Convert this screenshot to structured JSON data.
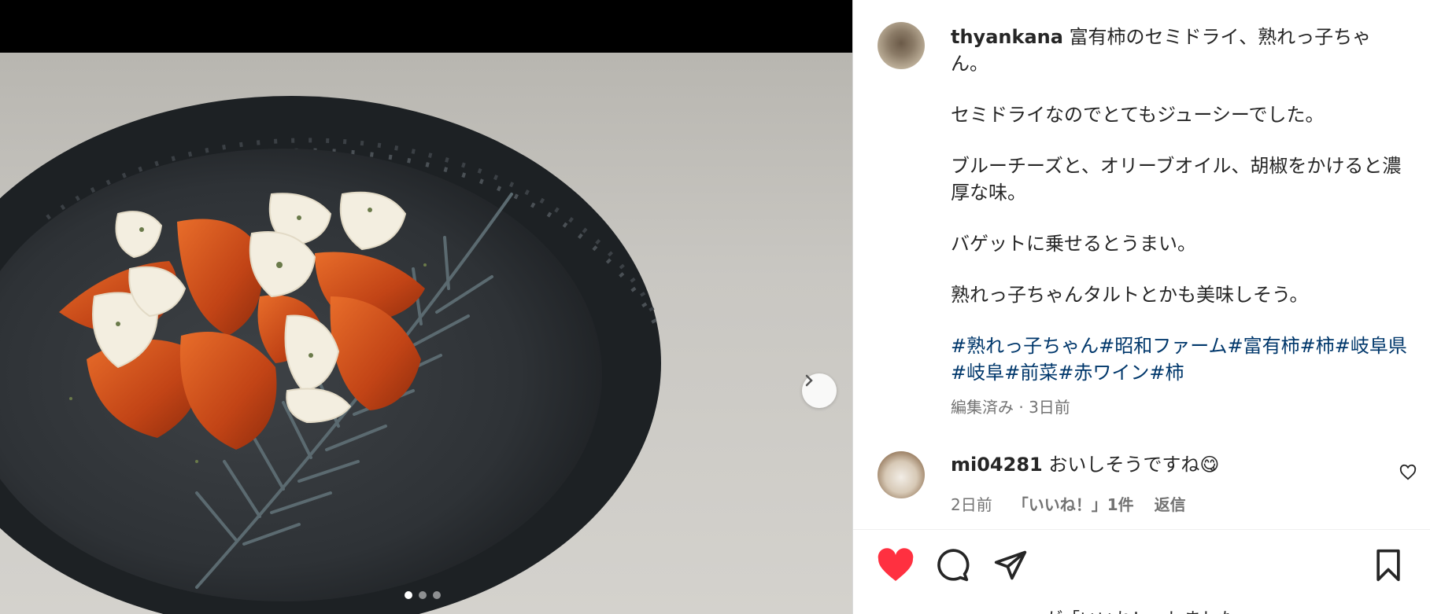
{
  "post": {
    "username": "thyankana",
    "caption_first": "富有柿のセミドライ、熟れっ子ちゃん。",
    "paragraphs": [
      "セミドライなのでとてもジューシーでした。",
      "ブルーチーズと、オリーブオイル、胡椒をかけると濃厚な味。",
      "バゲットに乗せるとうまい。",
      "熟れっ子ちゃんタルトとかも美味しそう。"
    ],
    "hashtags": [
      "#熟れっ子ちゃん",
      "#昭和ファーム",
      "#富有柿",
      "#柿",
      "#岐阜県",
      "#岐阜",
      "#前菜",
      "#赤ワイン",
      "#柿"
    ],
    "edited_label": "編集済み · 3日前"
  },
  "comment": {
    "username": "mi04281",
    "text": "おいしそうですね😋",
    "time": "2日前",
    "likes": "「いいね！」1件",
    "reply": "返信"
  },
  "carousel": {
    "slides": 3,
    "active": 0
  },
  "icons": {
    "next": "chevron-right-icon",
    "like": "heart-filled-icon",
    "comment": "comment-icon",
    "share": "paper-plane-icon",
    "save": "bookmark-icon",
    "comment_like": "heart-outline-icon"
  },
  "colors": {
    "like_red": "#ff3040",
    "hashtag": "#00376b",
    "meta": "#737373"
  },
  "partial_line": "…が「いいね！」しました"
}
